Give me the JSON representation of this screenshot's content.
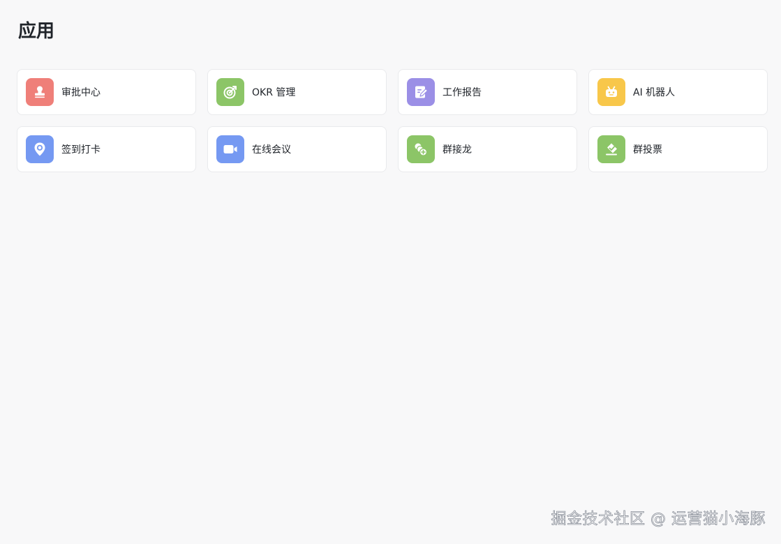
{
  "page": {
    "title": "应用"
  },
  "apps": [
    {
      "id": "approval",
      "label": "审批中心",
      "icon": "stamp-icon",
      "color": "#ef7f79"
    },
    {
      "id": "okr",
      "label": "OKR 管理",
      "icon": "target-icon",
      "color": "#8cc567"
    },
    {
      "id": "work-report",
      "label": "工作报告",
      "icon": "report-icon",
      "color": "#9b8fe6"
    },
    {
      "id": "ai-robot",
      "label": "AI 机器人",
      "icon": "robot-icon",
      "color": "#f8c74a"
    },
    {
      "id": "check-in",
      "label": "签到打卡",
      "icon": "location-pin-icon",
      "color": "#7599f2"
    },
    {
      "id": "meeting",
      "label": "在线会议",
      "icon": "video-camera-icon",
      "color": "#7599f2"
    },
    {
      "id": "relay",
      "label": "群接龙",
      "icon": "relay-icon",
      "color": "#8cc567"
    },
    {
      "id": "vote",
      "label": "群投票",
      "icon": "vote-icon",
      "color": "#8cc567"
    }
  ],
  "watermark": {
    "text": "掘金技术社区 @ 运营猫小海豚"
  }
}
